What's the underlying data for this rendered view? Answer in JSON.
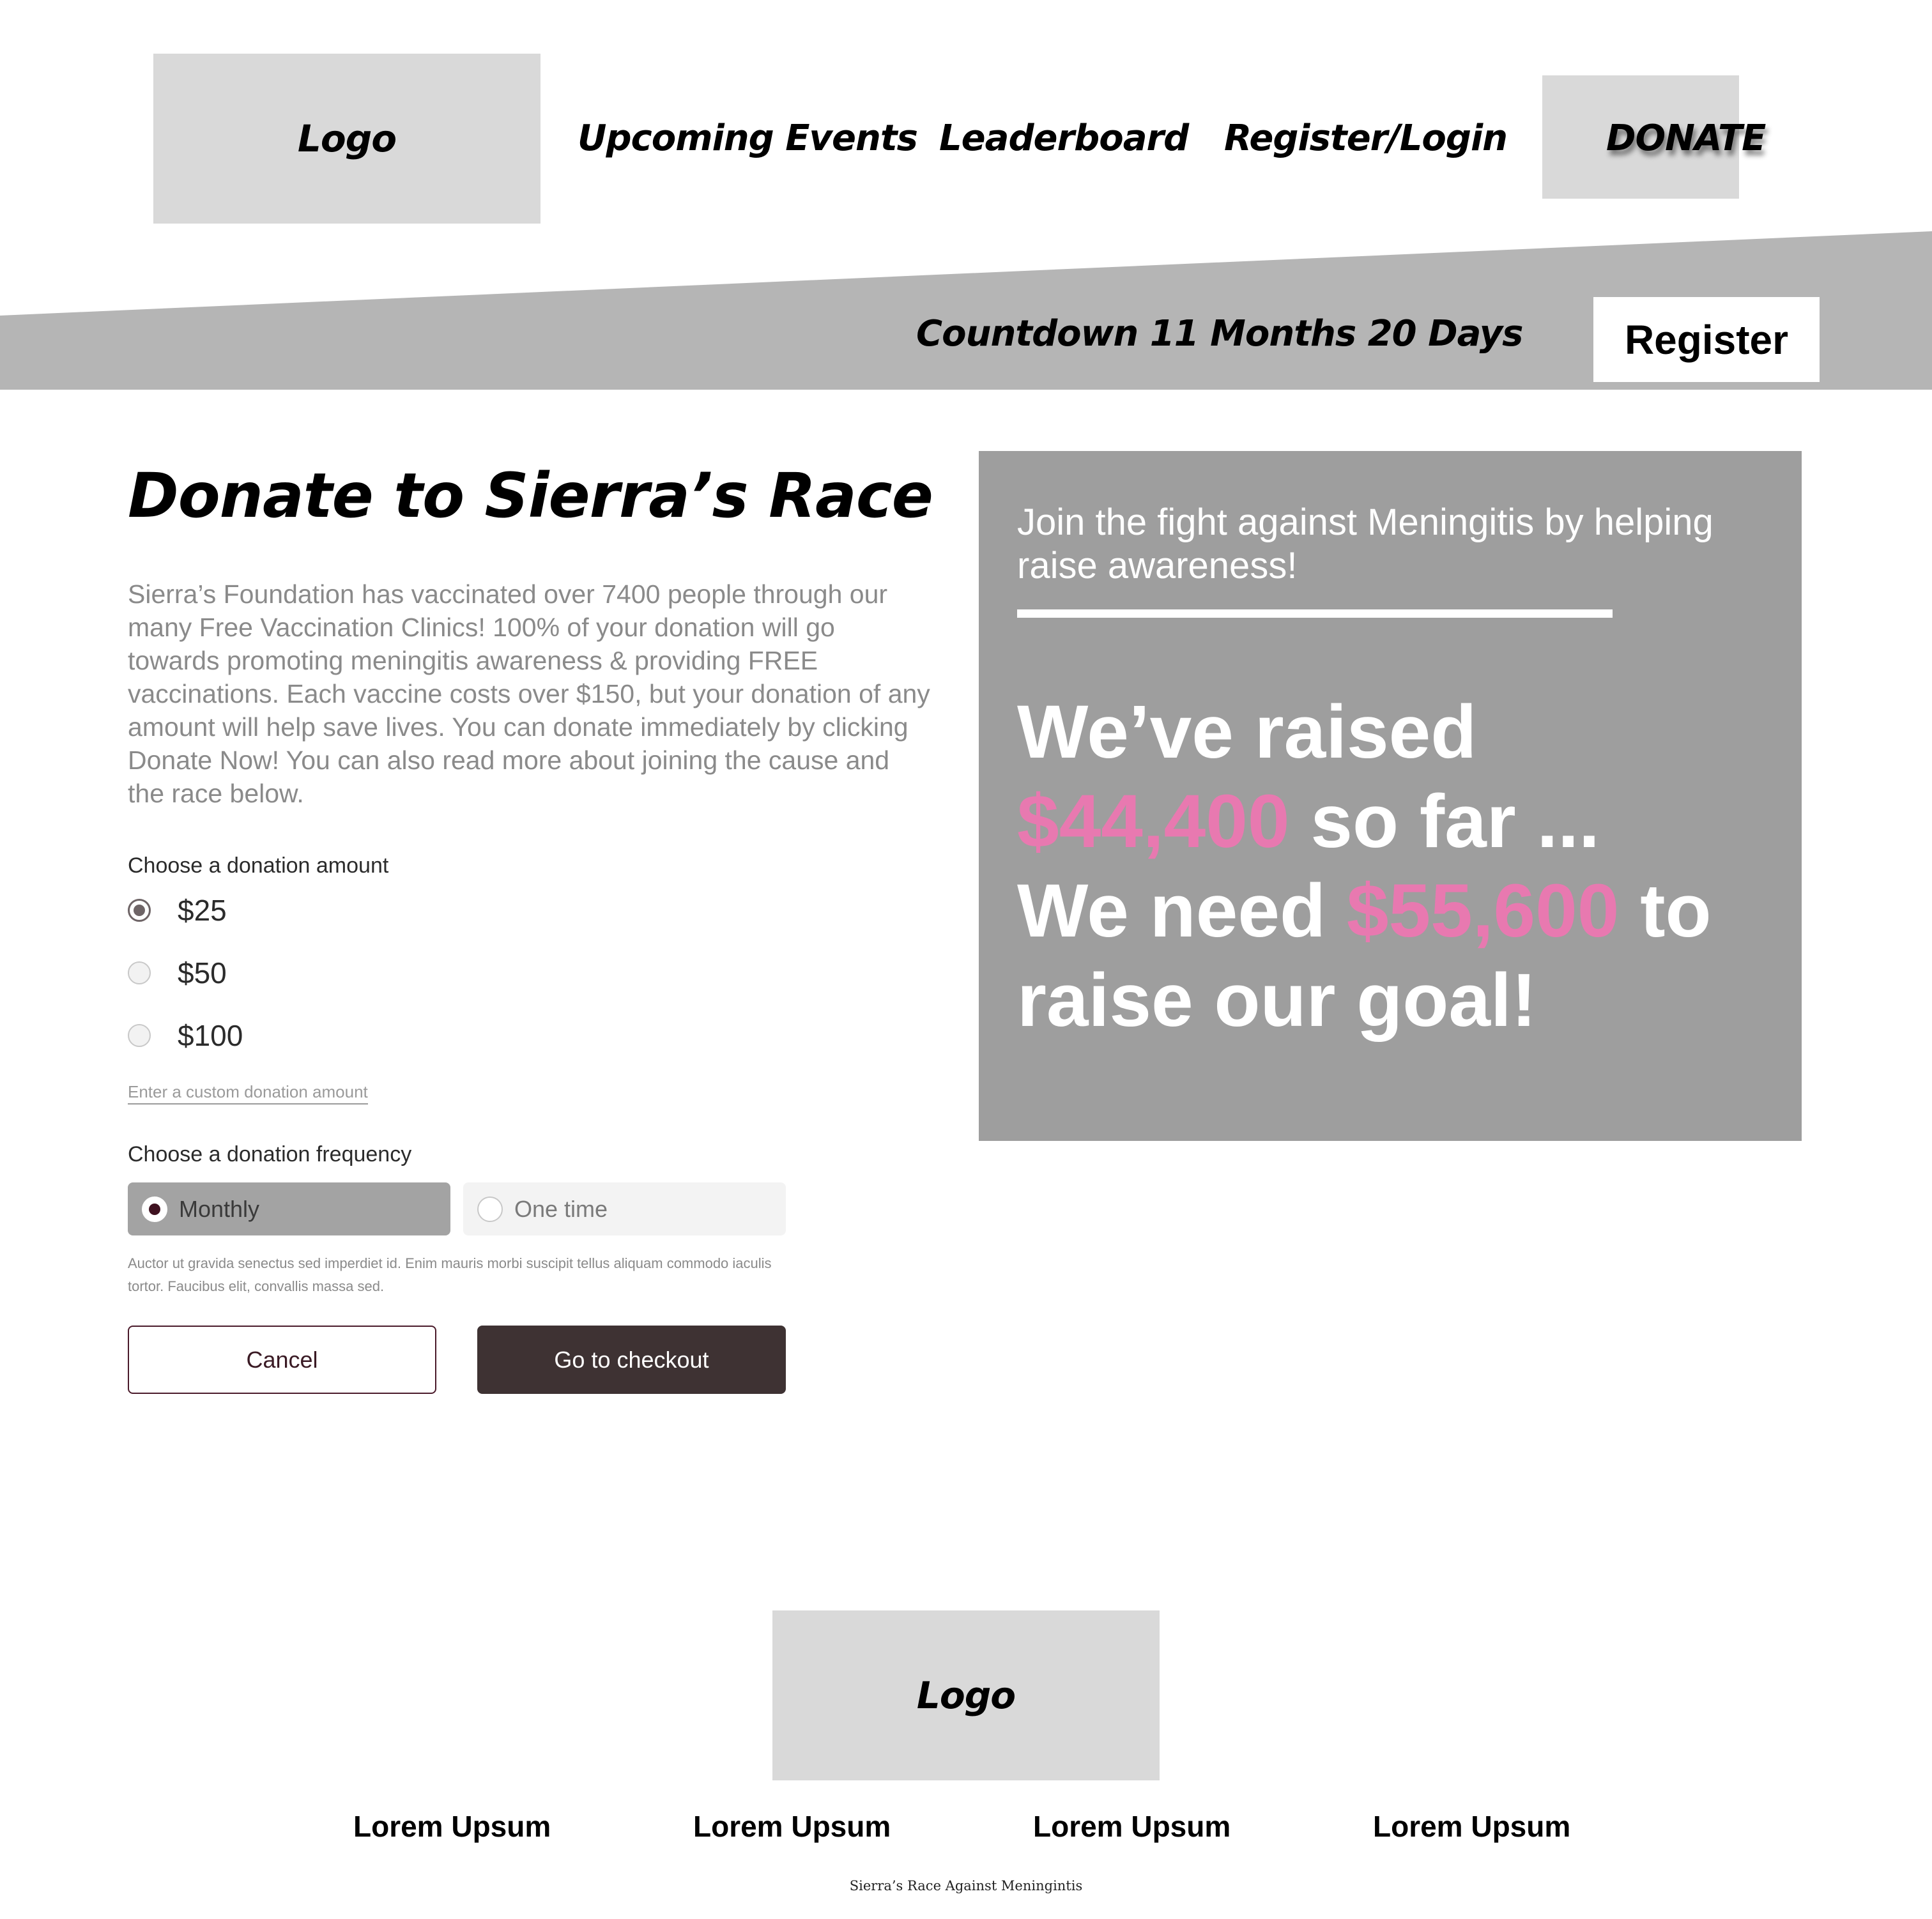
{
  "header": {
    "logo_text": "Logo",
    "nav": [
      {
        "label": "Upcoming Events"
      },
      {
        "label": "Leaderboard"
      },
      {
        "label": "Register/Login"
      }
    ],
    "donate_label": "DONATE"
  },
  "band": {
    "countdown": "Countdown 11 Months 20 Days",
    "register_label": "Register"
  },
  "main": {
    "title": "Donate to Sierra’s Race",
    "intro": "Sierra’s Foundation has vaccinated over 7400 people through our many Free Vaccination Clinics! 100% of your donation will go towards promoting meningitis awareness & providing FREE vaccinations. Each vaccine costs over $150, but your donation of any amount will help save lives. You can donate immediately by clicking Donate Now! You can also read more about joining the cause and the race below.",
    "amount_label": "Choose a donation amount",
    "amounts": [
      {
        "label": "$25",
        "selected": true
      },
      {
        "label": "$50",
        "selected": false
      },
      {
        "label": "$100",
        "selected": false
      }
    ],
    "custom_amount_link": "Enter a custom donation amount",
    "frequency_label": "Choose a donation frequency",
    "frequencies": [
      {
        "label": "Monthly",
        "selected": true
      },
      {
        "label": "One time",
        "selected": false
      }
    ],
    "fine_print": "Auctor ut gravida senectus sed imperdiet id. Enim mauris morbi suscipit tellus aliquam commodo iaculis tortor. Faucibus elit, convallis massa sed.",
    "cancel_label": "Cancel",
    "checkout_label": "Go to checkout"
  },
  "panel": {
    "subtitle": "Join the fight against Meningitis by helping raise awareness!",
    "raised_prefix": "We’ve raised",
    "raised_amount": "$44,400",
    "raised_suffix": "so far ...",
    "need_prefix": "We need",
    "need_amount": "$55,600",
    "need_suffix": "to raise our goal!"
  },
  "footer": {
    "logo_text": "Logo",
    "links": [
      "Lorem Upsum",
      "Lorem Upsum",
      "Lorem Upsum",
      "Lorem Upsum"
    ],
    "credit": "Sierra’s Race Against Meningintis"
  },
  "colors": {
    "logo_placeholder": "#d9d9d9",
    "band": "#b5b5b5",
    "panel": "#9e9e9e",
    "highlight_pink": "#e879b0",
    "checkout_button": "#3e3233",
    "cancel_border": "#4a1a2a",
    "monthly_selected": "#a3a3a3",
    "one_time_bg": "#f3f3f3"
  }
}
